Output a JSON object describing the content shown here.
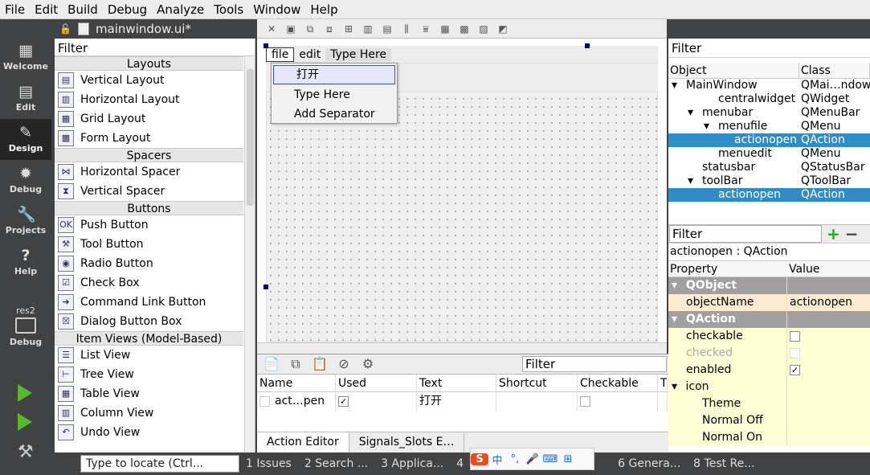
{
  "menu": [
    "File",
    "Edit",
    "Build",
    "Debug",
    "Analyze",
    "Tools",
    "Window",
    "Help"
  ],
  "modes": [
    {
      "label": "Welcome",
      "icon": "grid-icon"
    },
    {
      "label": "Edit",
      "icon": "document-icon"
    },
    {
      "label": "Design",
      "icon": "pencil-icon"
    },
    {
      "label": "Debug",
      "icon": "bug-icon"
    },
    {
      "label": "Projects",
      "icon": "wrench-icon"
    },
    {
      "label": "Help",
      "icon": "help-icon"
    }
  ],
  "kit": {
    "name": "res2",
    "label": "Debug"
  },
  "doc_tab": "mainwindow.ui*",
  "widgetbox": {
    "filter": "Filter",
    "sections": [
      {
        "title": "Layouts",
        "items": [
          "Vertical Layout",
          "Horizontal Layout",
          "Grid Layout",
          "Form Layout"
        ]
      },
      {
        "title": "Spacers",
        "items": [
          "Horizontal Spacer",
          "Vertical Spacer"
        ]
      },
      {
        "title": "Buttons",
        "items": [
          "Push Button",
          "Tool Button",
          "Radio Button",
          "Check Box",
          "Command Link Button",
          "Dialog Button Box"
        ]
      },
      {
        "title": "Item Views (Model-Based)",
        "items": [
          "List View",
          "Tree View",
          "Table View",
          "Column View",
          "Undo View"
        ]
      }
    ]
  },
  "form": {
    "menus": [
      "file",
      "edit",
      "Type Here"
    ],
    "dropdown": [
      "打开",
      "Type Here",
      "Add Separator"
    ]
  },
  "action_editor": {
    "filter": "Filter",
    "columns": [
      "Name",
      "Used",
      "Text",
      "Shortcut",
      "Checkable",
      "T"
    ],
    "rows": [
      {
        "name": "act…pen",
        "used": "✓",
        "text": "打开",
        "shortcut": "",
        "checkable": ""
      }
    ],
    "tabs": [
      "Action Editor",
      "Signals_Slots E…"
    ]
  },
  "object_inspector": {
    "filter": "Filter",
    "columns": [
      "Object",
      "Class"
    ],
    "rows": [
      {
        "object": "MainWindow",
        "class": "QMai…ndow",
        "arrow": "▾",
        "indent": 0,
        "selected": false
      },
      {
        "object": "centralwidget",
        "class": "QWidget",
        "arrow": "",
        "indent": 2,
        "selected": false
      },
      {
        "object": "menubar",
        "class": "QMenuBar",
        "arrow": "▾",
        "indent": 1,
        "selected": false
      },
      {
        "object": "menufile",
        "class": "QMenu",
        "arrow": "▾",
        "indent": 2,
        "selected": false
      },
      {
        "object": "actionopen",
        "class": "QAction",
        "arrow": "",
        "indent": 3,
        "selected": true
      },
      {
        "object": "menuedit",
        "class": "QMenu",
        "arrow": "",
        "indent": 2,
        "selected": false
      },
      {
        "object": "statusbar",
        "class": "QStatusBar",
        "arrow": "",
        "indent": 1,
        "selected": false
      },
      {
        "object": "toolBar",
        "class": "QToolBar",
        "arrow": "▾",
        "indent": 1,
        "selected": false
      },
      {
        "object": "actionopen",
        "class": "QAction",
        "arrow": "",
        "indent": 2,
        "selected": true
      }
    ]
  },
  "property_editor": {
    "filter": "Filter",
    "title": "actionopen : QAction",
    "columns": [
      "Property",
      "Value"
    ],
    "rows": [
      {
        "type": "group",
        "name": "QObject",
        "value": ""
      },
      {
        "type": "prop",
        "name": "objectName",
        "value": "actionopen",
        "style": "org"
      },
      {
        "type": "group",
        "name": "QAction",
        "value": ""
      },
      {
        "type": "prop",
        "name": "checkable",
        "value": "",
        "check": "empty",
        "style": "yel"
      },
      {
        "type": "prop",
        "name": "checked",
        "value": "",
        "check": "empty",
        "style": "yel dis"
      },
      {
        "type": "prop",
        "name": "enabled",
        "value": "",
        "check": "checked",
        "style": "yel"
      },
      {
        "type": "sub",
        "name": "icon",
        "value": "",
        "style": "yel"
      },
      {
        "type": "prop2",
        "name": "Theme",
        "value": "",
        "style": "yel"
      },
      {
        "type": "prop2",
        "name": "Normal Off",
        "value": "",
        "style": "yel"
      },
      {
        "type": "prop2",
        "name": "Normal On",
        "value": "",
        "style": "yel"
      }
    ]
  },
  "statusbar": {
    "locate_placeholder": "Type to locate (Ctrl...",
    "items": [
      "1  Issues",
      "2  Search ...",
      "3  Applica...",
      "4",
      "6  Genera...",
      "8  Test Re..."
    ]
  },
  "colors": {
    "selection": "#308cc6",
    "property_group": "#a0a0a0",
    "property_yellow": "#ffffd6"
  }
}
